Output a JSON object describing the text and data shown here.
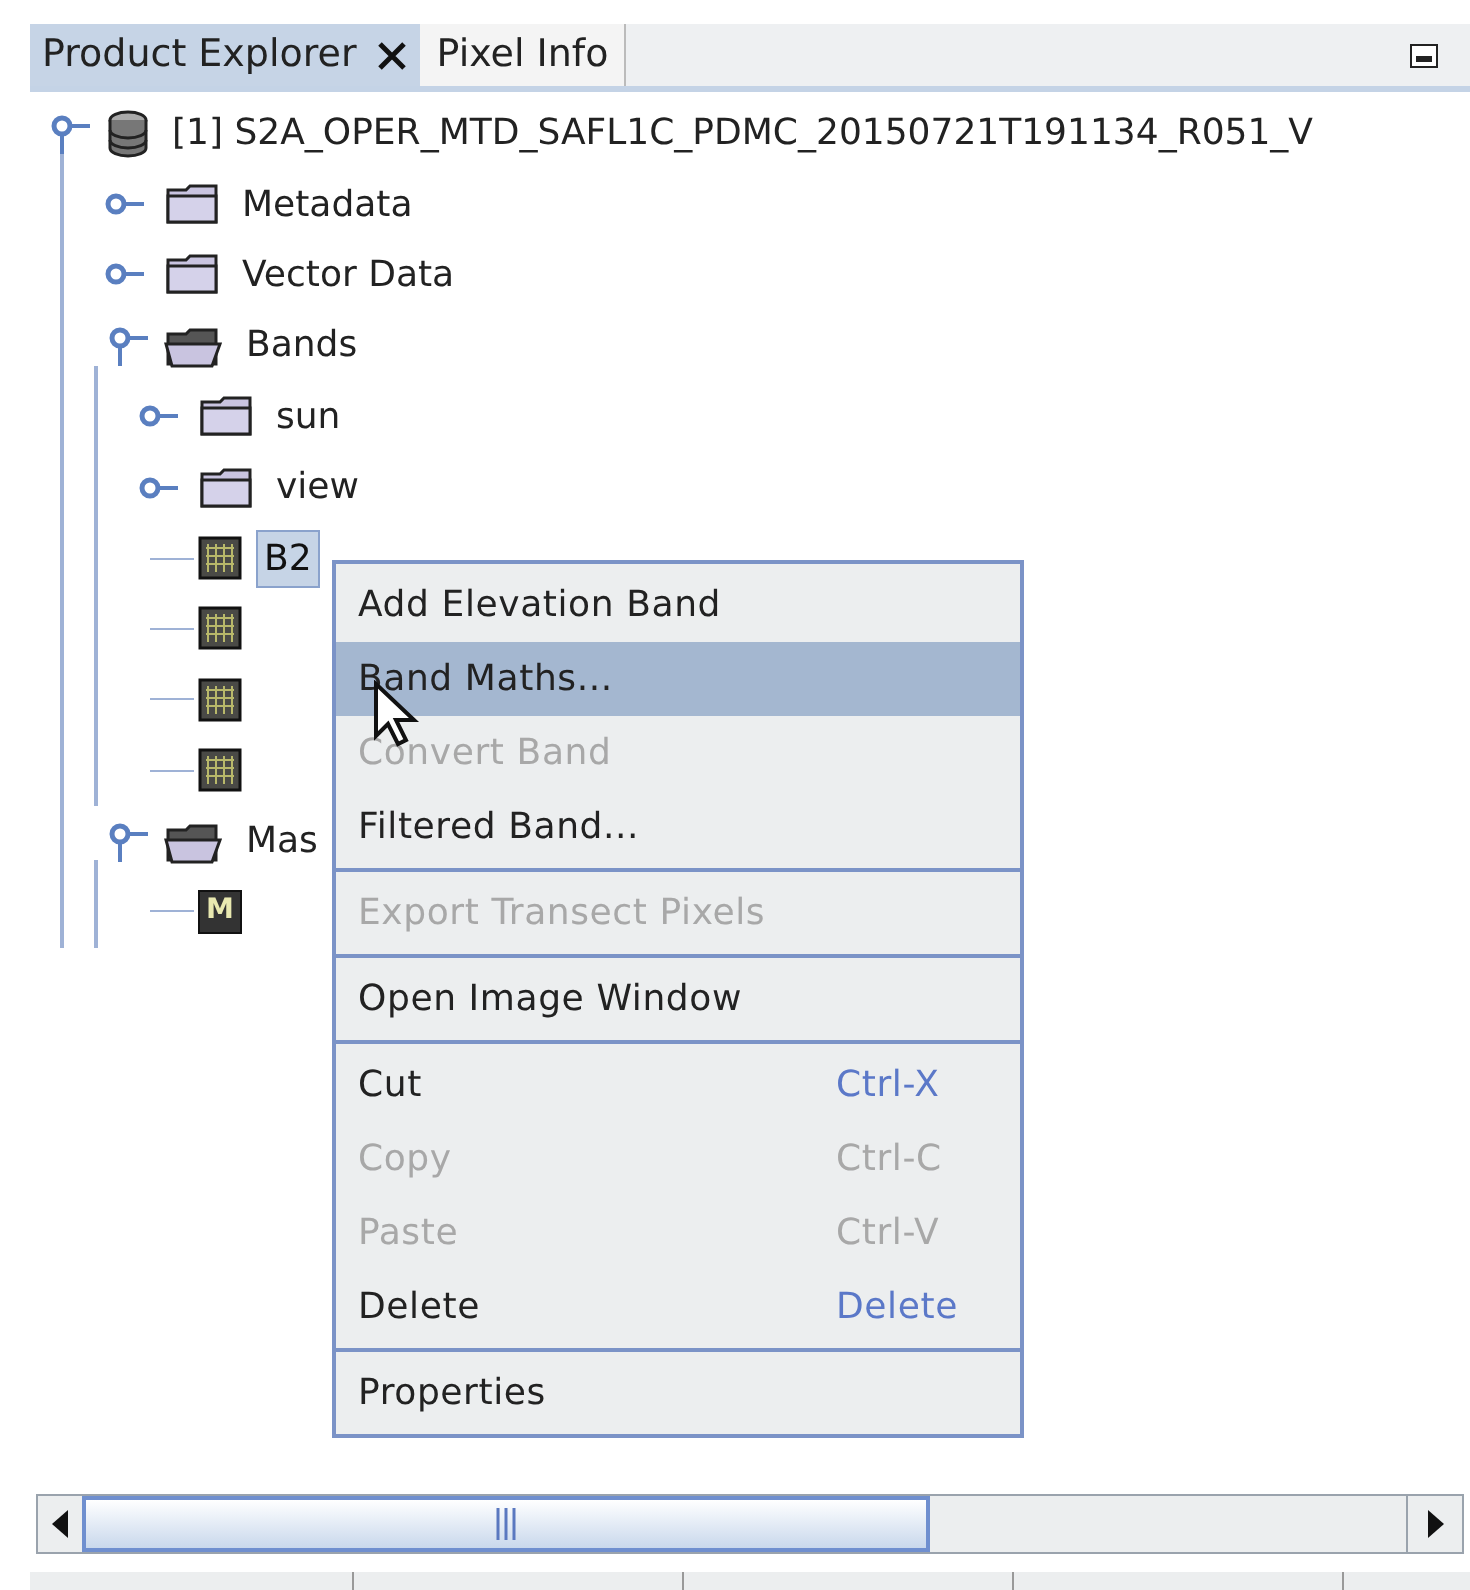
{
  "tabs": [
    {
      "label": "Product Explorer",
      "selected": true,
      "closable": true
    },
    {
      "label": "Pixel Info",
      "selected": false,
      "closable": false
    }
  ],
  "tree": [
    {
      "kind": "product",
      "label": "[1] S2A_OPER_MTD_SAFL1C_PDMC_20150721T191134_R051_V",
      "expanded": true,
      "children": [
        {
          "kind": "folder",
          "label": "Metadata",
          "expanded": false
        },
        {
          "kind": "folder",
          "label": "Vector Data",
          "expanded": false
        },
        {
          "kind": "folder",
          "label": "Bands",
          "expanded": true,
          "children": [
            {
              "kind": "folder",
              "label": "sun",
              "expanded": false
            },
            {
              "kind": "folder",
              "label": "view",
              "expanded": false
            },
            {
              "kind": "band",
              "label": "B2",
              "selected": true
            },
            {
              "kind": "band"
            },
            {
              "kind": "band"
            },
            {
              "kind": "band"
            }
          ]
        },
        {
          "kind": "folder",
          "label": "Mas",
          "expanded": true,
          "children": [
            {
              "kind": "mask",
              "icon_text": "M"
            }
          ]
        }
      ]
    }
  ],
  "context_menu": {
    "groups": [
      [
        {
          "label": "Add Elevation Band",
          "disabled": false,
          "selected": false
        },
        {
          "label": "Band Maths...",
          "disabled": false,
          "selected": true
        },
        {
          "label": "Convert Band",
          "disabled": true,
          "selected": false
        },
        {
          "label": "Filtered Band...",
          "disabled": false,
          "selected": false
        }
      ],
      [
        {
          "label": "Export Transect Pixels",
          "disabled": true,
          "selected": false
        }
      ],
      [
        {
          "label": "Open Image Window",
          "disabled": false,
          "selected": false
        }
      ],
      [
        {
          "label": "Cut",
          "shortcut": "Ctrl-X",
          "disabled": false,
          "selected": false
        },
        {
          "label": "Copy",
          "shortcut": "Ctrl-C",
          "disabled": true,
          "selected": false
        },
        {
          "label": "Paste",
          "shortcut": "Ctrl-V",
          "disabled": true,
          "selected": false
        },
        {
          "label": "Delete",
          "shortcut": "Delete",
          "disabled": false,
          "selected": false
        }
      ],
      [
        {
          "label": "Properties",
          "disabled": false,
          "selected": false
        }
      ]
    ]
  }
}
